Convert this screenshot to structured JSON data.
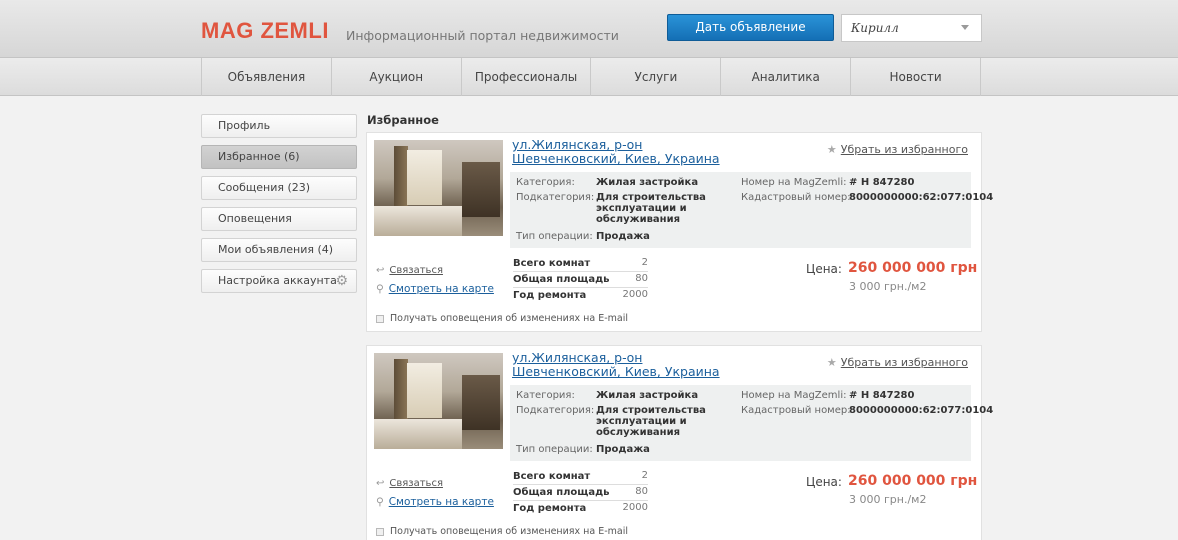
{
  "header": {
    "logo": "MAG ZEMLI",
    "tagline": "Информационный портал недвижимости",
    "post_button": "Дать объявление",
    "user_name": "Кирилл"
  },
  "nav": {
    "items": [
      "Объявления",
      "Аукцион",
      "Профессионалы",
      "Услуги",
      "Аналитика",
      "Новости"
    ]
  },
  "sidebar": {
    "items": [
      "Профиль",
      "Избранное (6)",
      "Сообщения (23)",
      "Оповещения",
      "Мои объявления (4)",
      "Настройка аккаунта"
    ],
    "active": "Избранное (6)"
  },
  "main": {
    "title": "Избранное",
    "listings": [
      {
        "address": "ул.Жилянская, р-он Шевченковский, Киев, Украина",
        "remove": "Убрать из избранного",
        "category_label": "Категория:",
        "category": "Жилая застройка",
        "subcategory_label": "Подкатегория:",
        "subcategory": "Для строительства эксплуатации и обслуживания",
        "operation_label": "Тип операции:",
        "operation": "Продажа",
        "number_label": "Номер на MagZemli:",
        "number": "# Н 847280",
        "cadastral_label": "Кадастровый номер:",
        "cadastral": "8000000000:62:077:0104",
        "contact": "Связаться",
        "map": "Смотреть на карте",
        "rooms_label": "Всего комнат",
        "rooms": "2",
        "area_label": "Общая площадь",
        "area": "80",
        "repair_label": "Год ремонта",
        "repair": "2000",
        "price_label": "Цена:",
        "price": "260 000 000 грн",
        "price_per": "3 000 грн./м2",
        "notify": "Получать оповещения об изменениях на E-mail"
      },
      {
        "address": "ул.Жилянская, р-он Шевченковский, Киев, Украина",
        "remove": "Убрать из избранного",
        "category_label": "Категория:",
        "category": "Жилая застройка",
        "subcategory_label": "Подкатегория:",
        "subcategory": "Для строительства эксплуатации и обслуживания",
        "operation_label": "Тип операции:",
        "operation": "Продажа",
        "number_label": "Номер на MagZemli:",
        "number": "# Н 847280",
        "cadastral_label": "Кадастровый номер:",
        "cadastral": "8000000000:62:077:0104",
        "contact": "Связаться",
        "map": "Смотреть на карте",
        "rooms_label": "Всего комнат",
        "rooms": "2",
        "area_label": "Общая площадь",
        "area": "80",
        "repair_label": "Год ремонта",
        "repair": "2000",
        "price_label": "Цена:",
        "price": "260 000 000 грн",
        "price_per": "3 000 грн./м2",
        "notify": "Получать оповещения об изменениях на E-mail"
      }
    ]
  }
}
